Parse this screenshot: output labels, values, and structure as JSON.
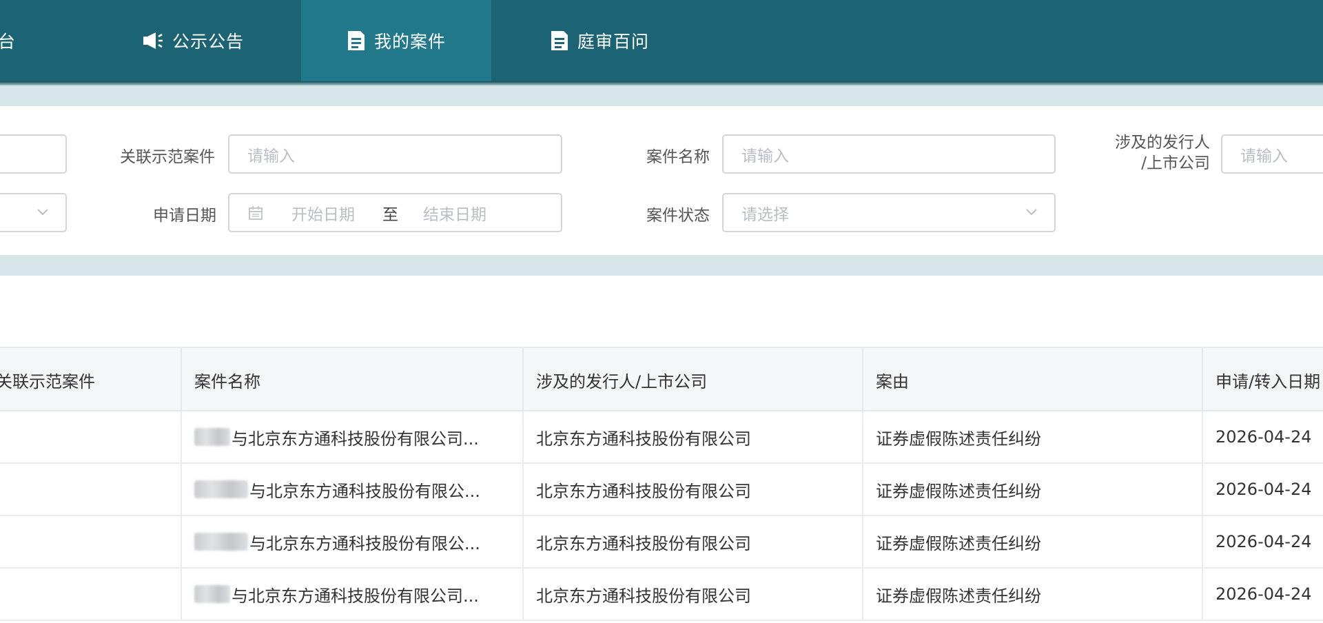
{
  "nav": {
    "items": [
      {
        "label": "台",
        "icon": "dashboard-icon"
      },
      {
        "label": "公示公告",
        "icon": "megaphone-icon"
      },
      {
        "label": "我的案件",
        "icon": "document-icon",
        "active": true
      },
      {
        "label": "庭审百问",
        "icon": "document-icon"
      }
    ],
    "colors": {
      "bar": "#1c6473",
      "active": "#21788a"
    }
  },
  "filters": {
    "related_case": {
      "label": "关联示范案件",
      "placeholder": "请输入"
    },
    "case_name": {
      "label": "案件名称",
      "placeholder": "请输入"
    },
    "issuer": {
      "label_line1": "涉及的发行人",
      "label_line2": "/上市公司",
      "placeholder": "请输入"
    },
    "apply_date": {
      "label": "申请日期",
      "start": "开始日期",
      "separator": "至",
      "end": "结束日期"
    },
    "case_status": {
      "label": "案件状态",
      "placeholder": "请选择"
    }
  },
  "table": {
    "headers": [
      "关联示范案件",
      "案件名称",
      "涉及的发行人/上市公司",
      "案由",
      "申请/转入日期"
    ],
    "header_visible": [
      "关联示范案件",
      "案件名称",
      "涉及的发行人/上市公司",
      "案由",
      "申请/转入日期"
    ],
    "rows": [
      {
        "related": "",
        "name": "与北京东方通科技股份有限公司...",
        "issuer": "北京东方通科技股份有限公司",
        "cause": "证券虚假陈述责任纠纷",
        "date": "2026-04-24"
      },
      {
        "related": "",
        "name": "与北京东方通科技股份有限公...",
        "issuer": "北京东方通科技股份有限公司",
        "cause": "证券虚假陈述责任纠纷",
        "date": "2026-04-24"
      },
      {
        "related": "",
        "name": "与北京东方通科技股份有限公...",
        "issuer": "北京东方通科技股份有限公司",
        "cause": "证券虚假陈述责任纠纷",
        "date": "2026-04-24"
      },
      {
        "related": "",
        "name": "与北京东方通科技股份有限公司...",
        "issuer": "北京东方通科技股份有限公司",
        "cause": "证券虚假陈述责任纠纷",
        "date": "2026-04-24"
      }
    ]
  }
}
